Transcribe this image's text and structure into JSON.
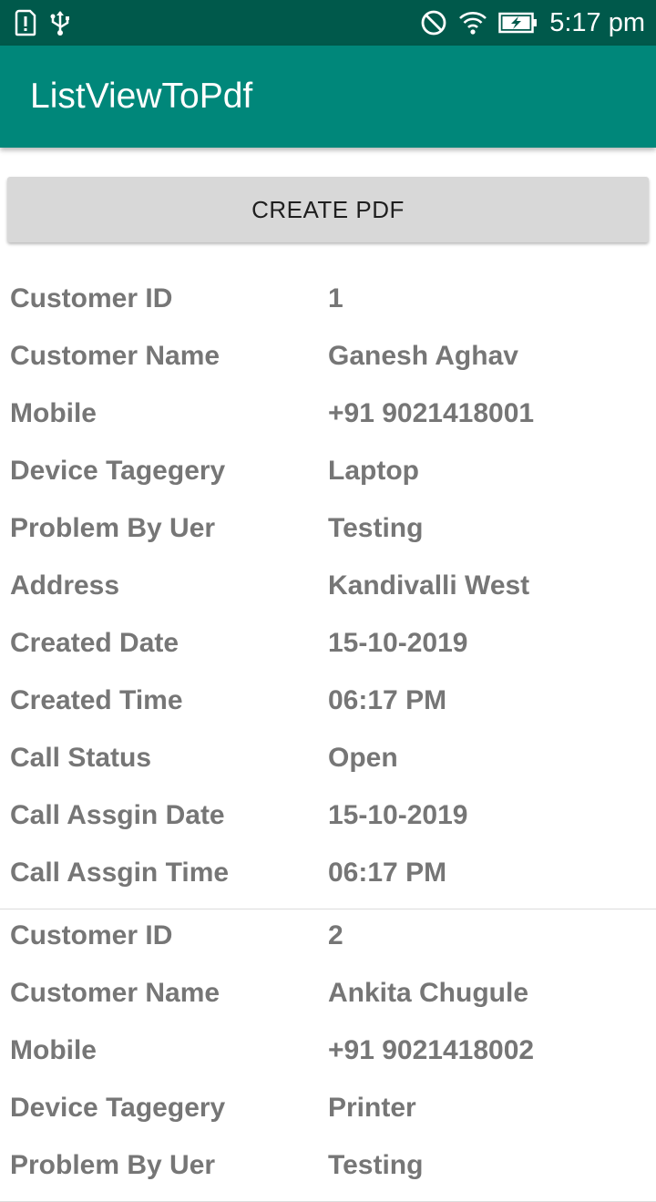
{
  "status_bar": {
    "time": "5:17 pm",
    "left_icons": [
      "sim-alert-icon",
      "usb-icon"
    ],
    "right_icons": [
      "do-not-disturb-icon",
      "wifi-icon",
      "battery-charging-icon"
    ]
  },
  "app_bar": {
    "title": "ListViewToPdf"
  },
  "create_button": {
    "label": "CREATE PDF"
  },
  "colors": {
    "status_bar": "#00594b",
    "app_bar": "#00877a",
    "button": "#d8d8d8",
    "text": "#767676"
  },
  "records": [
    {
      "fields": [
        {
          "label": "Customer ID",
          "value": "1"
        },
        {
          "label": "Customer Name",
          "value": "Ganesh Aghav"
        },
        {
          "label": "Mobile",
          "value": "+91 9021418001"
        },
        {
          "label": "Device Tagegery",
          "value": "Laptop"
        },
        {
          "label": "Problem By Uer",
          "value": "Testing"
        },
        {
          "label": "Address",
          "value": "Kandivalli West"
        },
        {
          "label": "Created Date",
          "value": "15-10-2019"
        },
        {
          "label": "Created Time",
          "value": "06:17 PM"
        },
        {
          "label": "Call Status",
          "value": "Open"
        },
        {
          "label": "Call Assgin Date",
          "value": "15-10-2019"
        },
        {
          "label": "Call Assgin Time",
          "value": "06:17 PM"
        }
      ]
    },
    {
      "fields": [
        {
          "label": "Customer ID",
          "value": "2"
        },
        {
          "label": "Customer Name",
          "value": "Ankita Chugule"
        },
        {
          "label": "Mobile",
          "value": "+91 9021418002"
        },
        {
          "label": "Device Tagegery",
          "value": "Printer"
        },
        {
          "label": "Problem By Uer",
          "value": "Testing"
        }
      ]
    }
  ]
}
